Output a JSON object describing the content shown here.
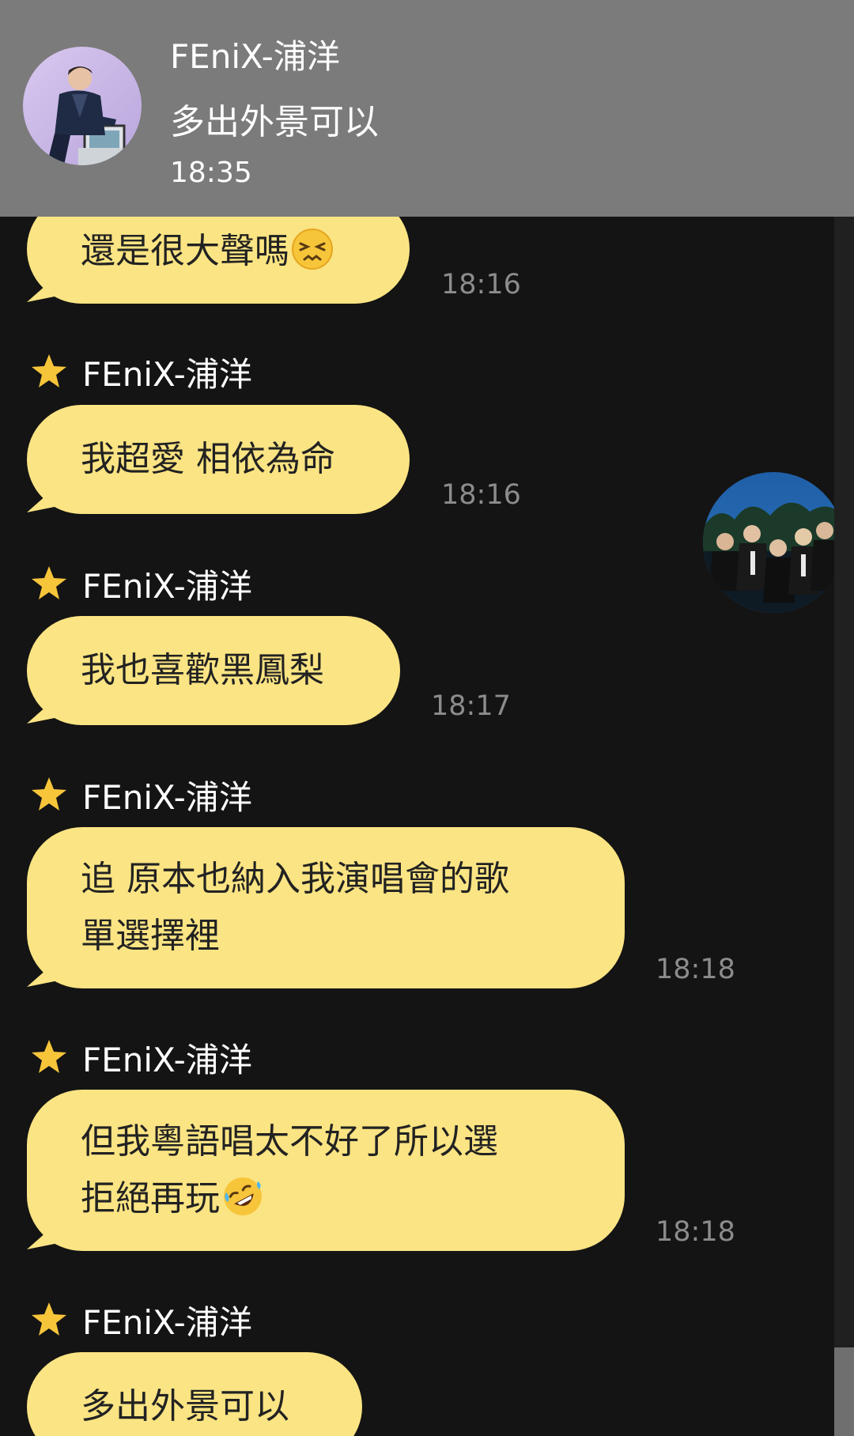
{
  "notification": {
    "sender": "FEniX-浦洋",
    "preview": "多出外景可以",
    "time": "18:35"
  },
  "messages": [
    {
      "text": "還是很大聲嗎",
      "emoji": "persevering-face",
      "time": "18:16"
    },
    {
      "sender": "FEniX-浦洋",
      "text": "我超愛 相依為命",
      "time": "18:16"
    },
    {
      "sender": "FEniX-浦洋",
      "text": "我也喜歡黑鳳梨",
      "time": "18:17"
    },
    {
      "sender": "FEniX-浦洋",
      "line1": "追 原本也納入我演唱會的歌",
      "line2": "單選擇裡",
      "time": "18:18"
    },
    {
      "sender": "FEniX-浦洋",
      "line1": "但我粵語唱太不好了所以選",
      "line2": "拒絕再玩",
      "emoji": "rolling-on-floor-laughing",
      "time": "18:18"
    },
    {
      "sender": "FEniX-浦洋",
      "text": "多出外景可以"
    }
  ],
  "icons": {
    "sender_badge": "star-icon"
  },
  "colors": {
    "background": "#141414",
    "bubble": "#fbe483",
    "banner": "#7b7b7b",
    "timestamp": "#8c8c8c",
    "star": "#f7c53a"
  }
}
